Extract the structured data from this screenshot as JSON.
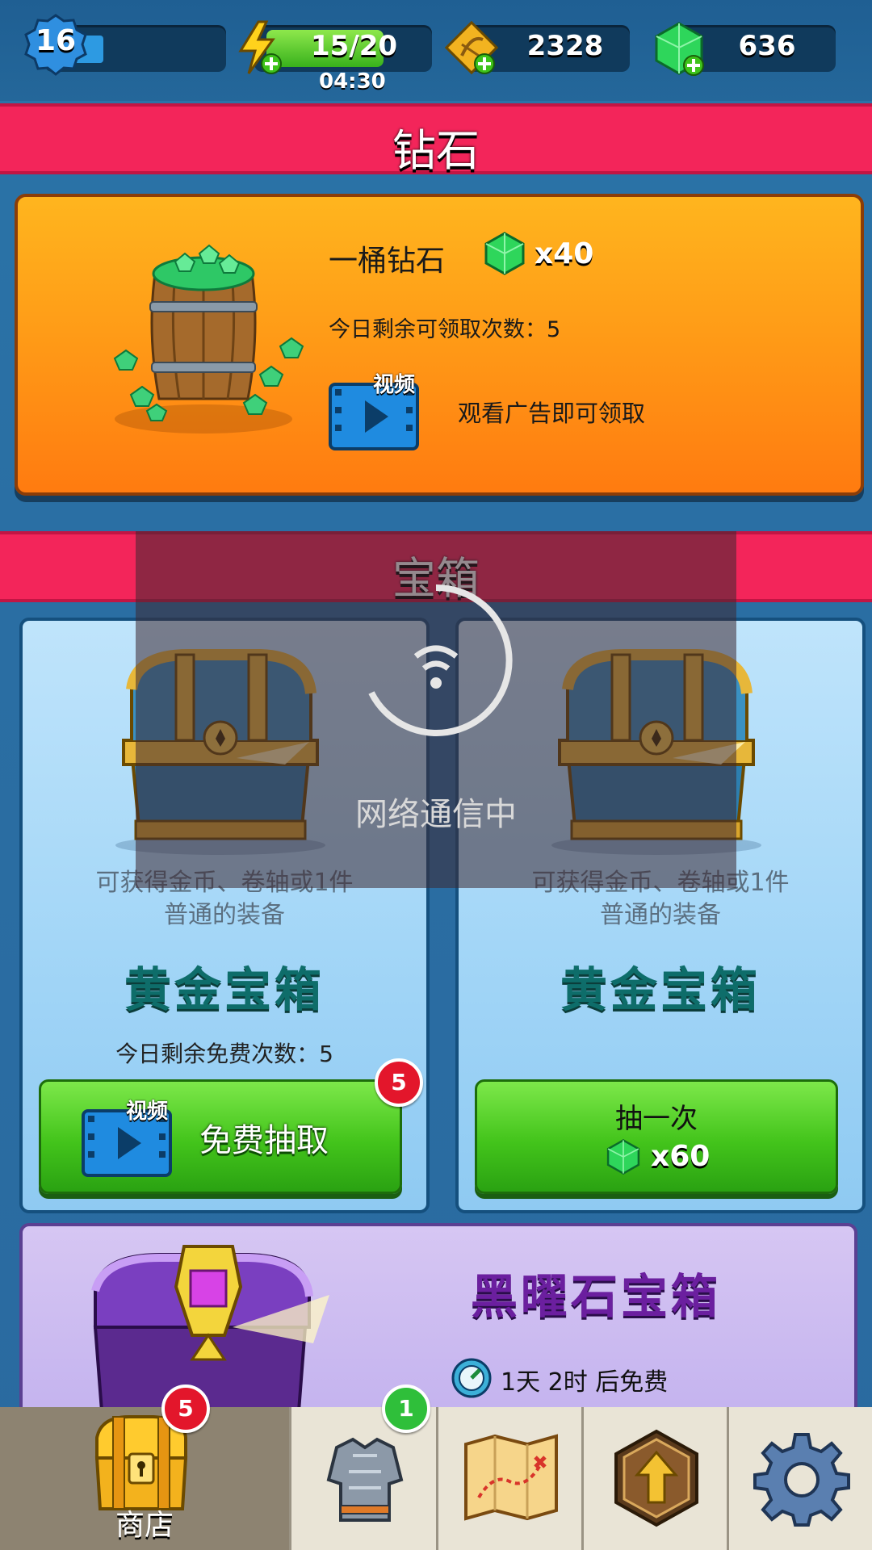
{
  "topbar": {
    "level": "16",
    "energy": "15/20",
    "energy_timer": "04:30",
    "scrolls": "2328",
    "gems": "636"
  },
  "diamond_section": {
    "banner": "钻石",
    "offer_name": "一桶钻石",
    "offer_amount": "x40",
    "remaining_claims": "今日剩余可领取次数：5",
    "video_tag": "视频",
    "watch_ad_text": "观看广告即可领取"
  },
  "chest_section": {
    "banner": "宝箱",
    "cards": [
      {
        "description_line1": "可获得金币、卷轴或1件",
        "description_line2": "普通的装备",
        "name": "黄金宝箱",
        "remaining_free": "今日剩余免费次数：5",
        "button_video_tag": "视频",
        "button_label": "免费抽取",
        "badge": "5"
      },
      {
        "description_line1": "可获得金币、卷轴或1件",
        "description_line2": "普通的装备",
        "name": "黄金宝箱",
        "button_label": "抽一次",
        "button_cost": "x60"
      }
    ]
  },
  "obsidian": {
    "name": "黑曜石宝箱",
    "timer_text": "1天 2时 后免费"
  },
  "loading_overlay": {
    "text": "网络通信中"
  },
  "bottom_nav": {
    "tabs": [
      {
        "label": "商店",
        "icon": "chest-icon",
        "badge": "5",
        "active": true
      },
      {
        "label": "",
        "icon": "armor-icon",
        "badge": "1",
        "active": false
      },
      {
        "label": "",
        "icon": "map-icon",
        "badge": "",
        "active": false
      },
      {
        "label": "",
        "icon": "upgrade-icon",
        "badge": "",
        "active": false
      },
      {
        "label": "",
        "icon": "gear-icon",
        "badge": "",
        "active": false
      }
    ]
  },
  "colors": {
    "banner_red": "#f3255a",
    "diamond_card_orange": "#ff9c17",
    "chest_card_blue": "#a3d6f7",
    "button_green": "#43c41b",
    "chest_name_teal": "#0e6d6a",
    "obsidian_purple": "#c2b1ee"
  }
}
